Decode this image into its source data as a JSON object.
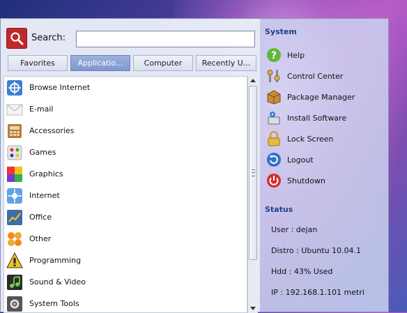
{
  "search": {
    "label": "Search:",
    "value": ""
  },
  "tabs": [
    {
      "label": "Favorites"
    },
    {
      "label": "Applicatio..."
    },
    {
      "label": "Computer"
    },
    {
      "label": "Recently U..."
    }
  ],
  "categories": [
    {
      "label": "Browse Internet",
      "icon": "browser-icon"
    },
    {
      "label": "E-mail",
      "icon": "email-icon"
    },
    {
      "label": "Accessories",
      "icon": "accessories-icon"
    },
    {
      "label": "Games",
      "icon": "games-icon"
    },
    {
      "label": "Graphics",
      "icon": "graphics-icon"
    },
    {
      "label": "Internet",
      "icon": "internet-icon"
    },
    {
      "label": "Office",
      "icon": "office-icon"
    },
    {
      "label": "Other",
      "icon": "other-icon"
    },
    {
      "label": "Programming",
      "icon": "programming-icon"
    },
    {
      "label": "Sound & Video",
      "icon": "sound-video-icon"
    },
    {
      "label": "System Tools",
      "icon": "system-tools-icon"
    }
  ],
  "system": {
    "title": "System",
    "items": [
      {
        "label": "Help",
        "icon": "help-icon"
      },
      {
        "label": "Control Center",
        "icon": "control-center-icon"
      },
      {
        "label": "Package Manager",
        "icon": "package-manager-icon"
      },
      {
        "label": "Install Software",
        "icon": "install-software-icon"
      },
      {
        "label": "Lock Screen",
        "icon": "lock-icon"
      },
      {
        "label": "Logout",
        "icon": "logout-icon"
      },
      {
        "label": "Shutdown",
        "icon": "shutdown-icon"
      }
    ]
  },
  "status": {
    "title": "Status",
    "lines": [
      "User : dejan",
      "Distro : Ubuntu 10.04.1",
      "Hdd : 43% Used",
      "IP :  192.168.1.101  metri"
    ]
  }
}
